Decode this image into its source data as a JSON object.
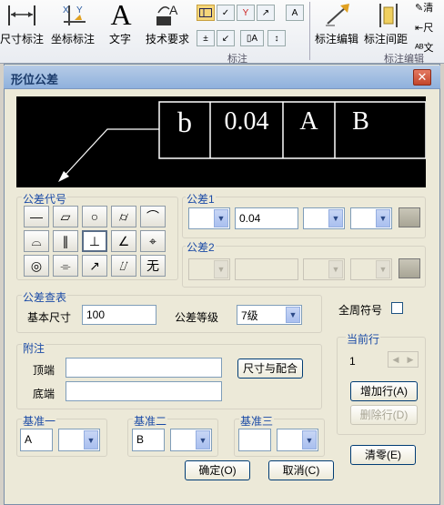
{
  "ribbon": {
    "items": [
      {
        "label": "尺寸标注"
      },
      {
        "label": "坐标标注"
      },
      {
        "label": "文字"
      },
      {
        "label": "技术要求"
      }
    ],
    "right_items": [
      {
        "label": "标注编辑"
      },
      {
        "label": "标注间距"
      }
    ],
    "partial_labels": {
      "top": "清",
      "mid": "尺",
      "bottom": "文"
    },
    "group_caption_left": "标注",
    "group_caption_right": "标注编辑"
  },
  "dialog": {
    "title": "形位公差",
    "close_glyph": "✕",
    "preview": {
      "frame_cells": [
        "b",
        "0.04",
        "A",
        "B"
      ]
    },
    "tol_symbol": {
      "title": "公差代号",
      "symbols": [
        "—",
        "▱",
        "○",
        "⌭",
        "⌒",
        "⌓",
        "∥",
        "⊥",
        "∠",
        "⌖",
        "◎",
        "⌯",
        "↗",
        "⌰",
        "无"
      ],
      "selected_index": 7
    },
    "tol1": {
      "title": "公差1",
      "value": "0.04"
    },
    "tol2": {
      "title": "公差2"
    },
    "lookup": {
      "title": "公差查表",
      "basic_size_label": "基本尺寸",
      "basic_size_value": "100",
      "grade_label": "公差等级",
      "grade_value": "7级"
    },
    "all_around_label": "全周符号",
    "current_row": {
      "title": "当前行",
      "value": "1",
      "add_row": "增加行(A)",
      "delete_row": "删除行(D)",
      "clear": "清零(E)"
    },
    "notes": {
      "title": "附注",
      "top_label": "顶端",
      "bottom_label": "底端",
      "fit_button": "尺寸与配合"
    },
    "datums": [
      {
        "title": "基准一",
        "value": "A"
      },
      {
        "title": "基准二",
        "value": "B"
      },
      {
        "title": "基准三",
        "value": ""
      }
    ],
    "ok": "确定(O)",
    "cancel": "取消(C)"
  }
}
